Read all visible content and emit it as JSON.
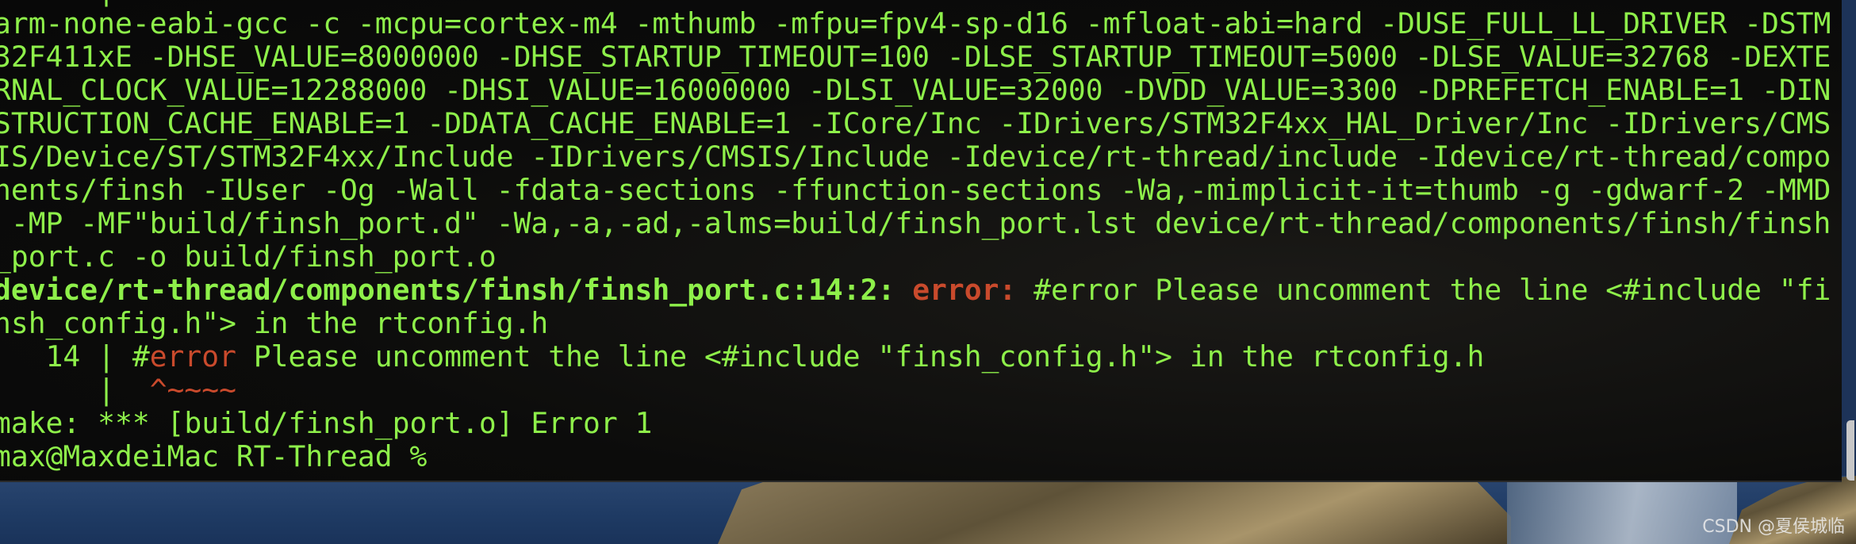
{
  "terminal": {
    "lines": [
      [
        {
          "t": "      |"
        }
      ],
      [
        {
          "t": "arm-none-eabi-gcc -c -mcpu=cortex-m4 -mthumb -mfpu=fpv4-sp-d16 -mfloat-abi=hard -DUSE_FULL_LL_DRIVER -DSTM"
        }
      ],
      [
        {
          "t": "32F411xE -DHSE_VALUE=8000000 -DHSE_STARTUP_TIMEOUT=100 -DLSE_STARTUP_TIMEOUT=5000 -DLSE_VALUE=32768 -DEXTE"
        }
      ],
      [
        {
          "t": "RNAL_CLOCK_VALUE=12288000 -DHSI_VALUE=16000000 -DLSI_VALUE=32000 -DVDD_VALUE=3300 -DPREFETCH_ENABLE=1 -DIN"
        }
      ],
      [
        {
          "t": "STRUCTION_CACHE_ENABLE=1 -DDATA_CACHE_ENABLE=1 -ICore/Inc -IDrivers/STM32F4xx_HAL_Driver/Inc -IDrivers/CMS"
        }
      ],
      [
        {
          "t": "IS/Device/ST/STM32F4xx/Include -IDrivers/CMSIS/Include -Idevice/rt-thread/include -Idevice/rt-thread/compo"
        }
      ],
      [
        {
          "t": "nents/finsh -IUser -Og -Wall -fdata-sections -ffunction-sections -Wa,-mimplicit-it=thumb -g -gdwarf-2 -MMD"
        }
      ],
      [
        {
          "t": " -MP -MF\"build/finsh_port.d\" -Wa,-a,-ad,-alms=build/finsh_port.lst device/rt-thread/components/finsh/finsh"
        }
      ],
      [
        {
          "t": "_port.c -o build/finsh_port.o"
        }
      ],
      [
        {
          "t": "device/rt-thread/components/finsh/finsh_port.c:14:2: ",
          "s": "b"
        },
        {
          "t": "error:",
          "s": "b err"
        },
        {
          "t": " #error Please uncomment the line <#include \"fi"
        }
      ],
      [
        {
          "t": "nsh_config.h\"> in the rtconfig.h"
        }
      ],
      [
        {
          "t": "   14 | #"
        },
        {
          "t": "error",
          "s": "err"
        },
        {
          "t": " Please uncomment the line <#include \"finsh_config.h\"> in the rtconfig.h"
        }
      ],
      [
        {
          "t": "      |  "
        },
        {
          "t": "^~~~~",
          "s": "err"
        }
      ],
      [
        {
          "t": "make: *** [build/finsh_port.o] Error 1"
        }
      ],
      [
        {
          "t": "max@MaxdeiMac RT-Thread % "
        }
      ]
    ]
  },
  "colors": {
    "text": "#8ef04a",
    "error": "#c94a2c",
    "background": "#0b0b0b"
  },
  "watermark": "CSDN @夏侯城临"
}
